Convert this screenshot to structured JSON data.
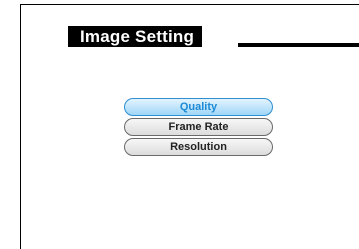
{
  "header": {
    "title": "Image Setting"
  },
  "menu": {
    "items": [
      {
        "label": "Quality",
        "selected": true
      },
      {
        "label": "Frame Rate",
        "selected": false
      },
      {
        "label": "Resolution",
        "selected": false
      }
    ]
  },
  "colors": {
    "selected_text": "#1d8ad6",
    "selected_fill": "#9fd6f7",
    "title_background": "#000000"
  }
}
